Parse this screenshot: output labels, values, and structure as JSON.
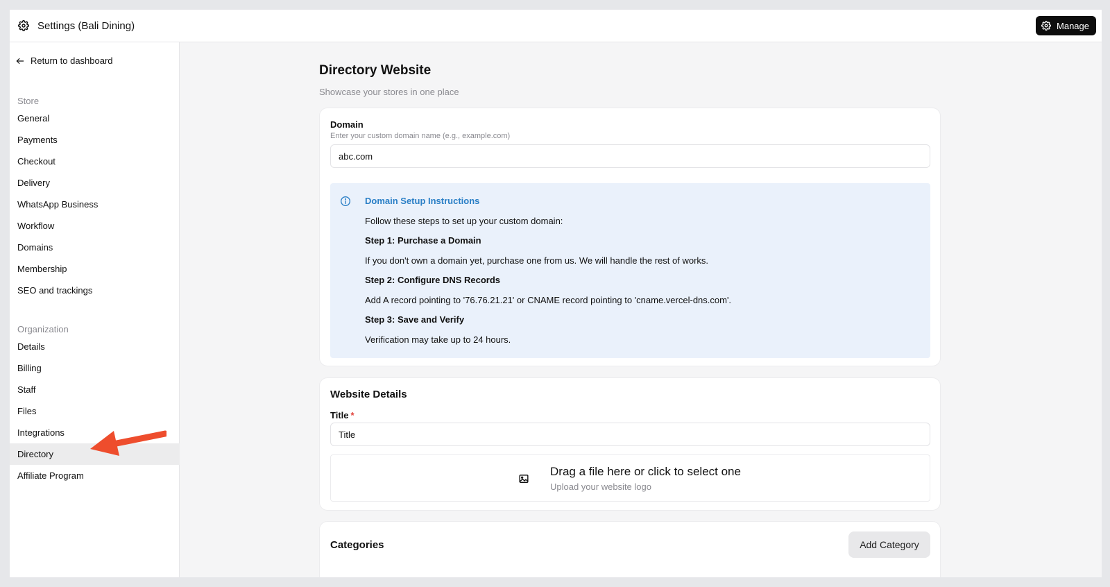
{
  "header": {
    "title": "Settings (Bali Dining)",
    "manage_label": "Manage"
  },
  "sidebar": {
    "return_label": "Return to dashboard",
    "store_label": "Store",
    "store_items": [
      "General",
      "Payments",
      "Checkout",
      "Delivery",
      "WhatsApp Business",
      "Workflow",
      "Domains",
      "Membership",
      "SEO and trackings"
    ],
    "org_label": "Organization",
    "org_items": [
      "Details",
      "Billing",
      "Staff",
      "Files",
      "Integrations",
      "Directory",
      "Affiliate Program"
    ],
    "active_item": "Directory"
  },
  "page": {
    "title": "Directory Website",
    "subtitle": "Showcase your stores in one place"
  },
  "domain": {
    "label": "Domain",
    "help": "Enter your custom domain name (e.g., example.com)",
    "value": "abc.com",
    "instructions": {
      "heading": "Domain Setup Instructions",
      "intro": "Follow these steps to set up your custom domain:",
      "step1_title": "Step 1: Purchase a Domain",
      "step1_text": "If you don't own a domain yet, purchase one from us. We will handle the rest of works.",
      "step2_title": "Step 2: Configure DNS Records",
      "step2_text": "Add A record pointing to '76.76.21.21' or CNAME record pointing to 'cname.vercel-dns.com'.",
      "step3_title": "Step 3: Save and Verify",
      "step3_text": "Verification may take up to 24 hours."
    }
  },
  "website_details": {
    "title": "Website Details",
    "title_label": "Title",
    "required_mark": "*",
    "title_value": "Title",
    "dropzone_title": "Drag a file here or click to select one",
    "dropzone_sub": "Upload your website logo"
  },
  "categories": {
    "title": "Categories",
    "add_label": "Add Category"
  },
  "colors": {
    "accent_blue": "#2a7fc6",
    "arrow": "#ee4d2d",
    "info_bg": "#eaf1fb"
  }
}
